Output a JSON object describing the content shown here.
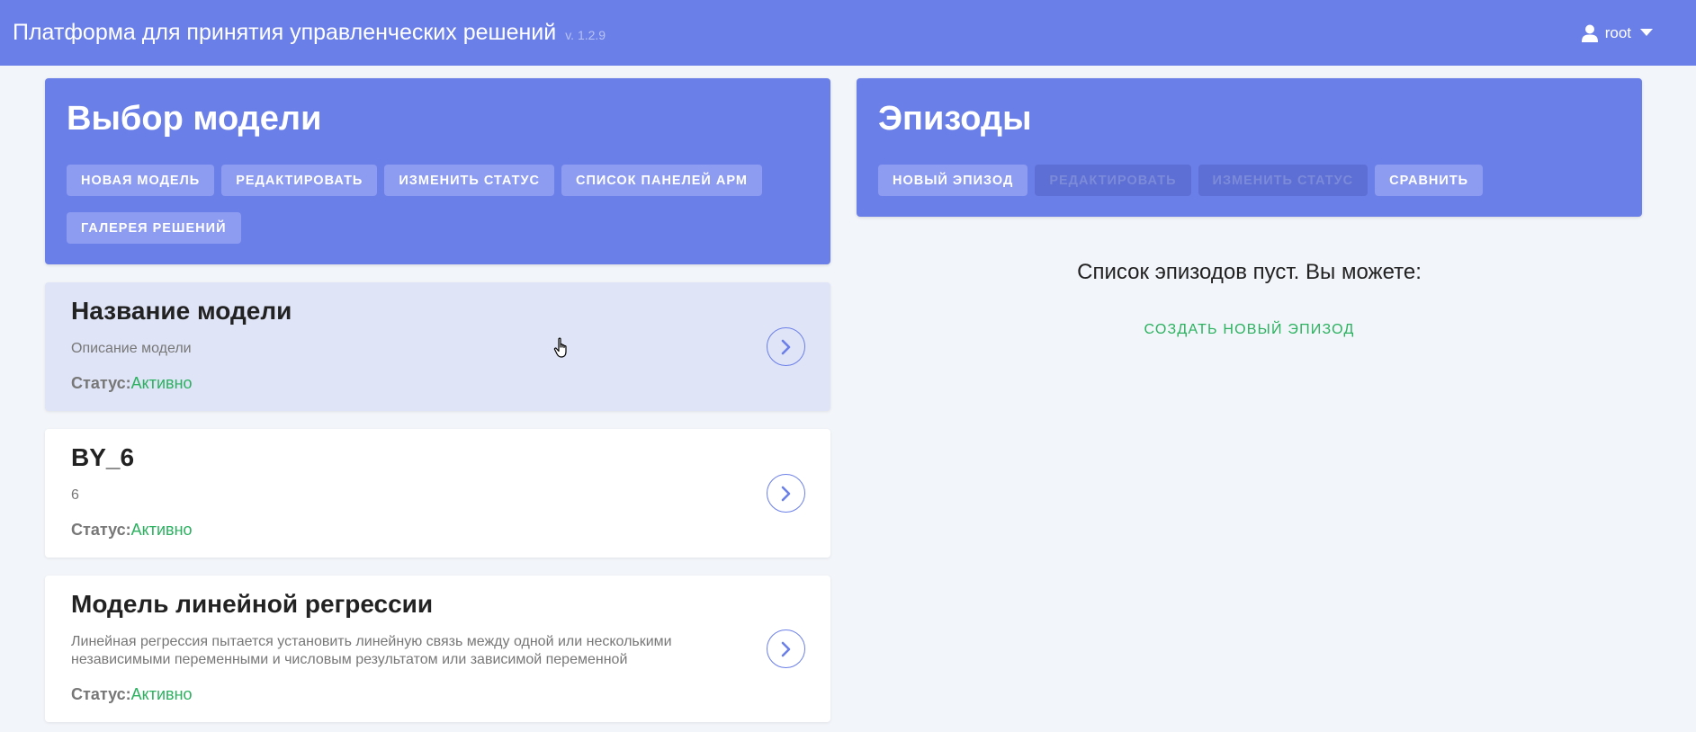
{
  "header": {
    "title": "Платформа для принятия управленческих решений",
    "version": "v. 1.2.9",
    "user": "root"
  },
  "models_panel": {
    "title": "Выбор модели",
    "buttons": [
      {
        "label": "Новая модель"
      },
      {
        "label": "Редактировать"
      },
      {
        "label": "Изменить статус"
      },
      {
        "label": "Список панелей АРМ"
      },
      {
        "label": "Галерея решений"
      }
    ]
  },
  "episodes_panel": {
    "title": "Эпизоды",
    "buttons": [
      {
        "label": "Новый эпизод",
        "enabled": true
      },
      {
        "label": "Редактировать",
        "enabled": false
      },
      {
        "label": "Изменить статус",
        "enabled": false
      },
      {
        "label": "Сравнить",
        "enabled": true
      }
    ],
    "empty_text": "Список эпизодов пуст. Вы можете:",
    "create_link": "создать новый эпизод"
  },
  "status_label": "Статус:",
  "models": [
    {
      "name": "Название модели",
      "description": "Описание модели",
      "status": "Активно",
      "selected": true
    },
    {
      "name": "BY_6",
      "description": "6",
      "status": "Активно",
      "selected": false
    },
    {
      "name": "Модель линейной регрессии",
      "description": "Линейная регрессия пытается установить линейную связь между одной или несколькими независимыми переменными и числовым результатом или зависимой переменной",
      "status": "Активно",
      "selected": false
    }
  ],
  "colors": {
    "primary": "#6b7fe8",
    "button": "#8d9cf0",
    "status_active": "#2bb15f",
    "selected_card": "#dfe4f7"
  }
}
